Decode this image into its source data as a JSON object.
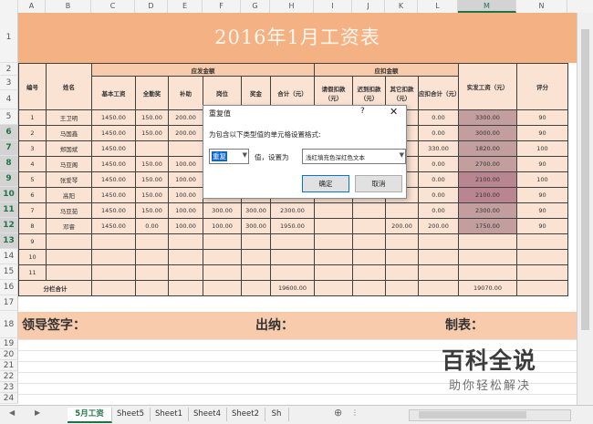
{
  "columns": [
    "A",
    "B",
    "C",
    "D",
    "E",
    "F",
    "G",
    "H",
    "I",
    "J",
    "K",
    "L",
    "M",
    "N"
  ],
  "rows": [
    "1",
    "2",
    "3",
    "4",
    "5",
    "6",
    "7",
    "8",
    "9",
    "10",
    "11",
    "12",
    "13",
    "14",
    "15",
    "16",
    "17",
    "18",
    "19",
    "20",
    "21",
    "22",
    "23",
    "24"
  ],
  "title": "2016年1月工资表",
  "headers": {
    "id": "编号",
    "name": "姓名",
    "payable_group": "应发金额",
    "deduct_group": "应扣金额",
    "net": "实发工资（元）",
    "score": "评分",
    "base": "基本工资",
    "attendance": "全勤奖",
    "subsidy": "补助",
    "post": "岗位",
    "bonus": "奖金",
    "total": "合计（元）",
    "leave": "请假扣款（元）",
    "late": "迟到扣款（元）",
    "other": "其它扣款（元）",
    "deduct_total": "应扣合计（元）"
  },
  "records": [
    {
      "no": "1",
      "name": "王卫明",
      "base": "1450.00",
      "att": "150.00",
      "sub": "200.00",
      "post": "",
      "bonus": "",
      "total": "",
      "leave": "",
      "late": "",
      "other": "",
      "dtotal": "0.00",
      "net": "3300.00",
      "score": "90"
    },
    {
      "no": "2",
      "name": "马国鑫",
      "base": "1450.00",
      "att": "150.00",
      "sub": "200.00",
      "post": "",
      "bonus": "",
      "total": "",
      "leave": "",
      "late": "",
      "other": "",
      "dtotal": "0.00",
      "net": "3000.00",
      "score": "90"
    },
    {
      "no": "3",
      "name": "郑国斌",
      "base": "1450.00",
      "att": "",
      "sub": "",
      "post": "",
      "bonus": "",
      "total": "",
      "leave": "",
      "late": "",
      "other": "",
      "dtotal": "330.00",
      "net": "1820.00",
      "score": "100"
    },
    {
      "no": "4",
      "name": "马亚阁",
      "base": "1450.00",
      "att": "150.00",
      "sub": "100.00",
      "post": "",
      "bonus": "",
      "total": "",
      "leave": "",
      "late": "",
      "other": "",
      "dtotal": "0.00",
      "net": "2700.00",
      "score": "90"
    },
    {
      "no": "5",
      "name": "张爱琴",
      "base": "1450.00",
      "att": "150.00",
      "sub": "100.00",
      "post": "",
      "bonus": "",
      "total": "",
      "leave": "",
      "late": "",
      "other": "",
      "dtotal": "0.00",
      "net": "2100.00",
      "score": "100"
    },
    {
      "no": "6",
      "name": "高阳",
      "base": "1450.00",
      "att": "150.00",
      "sub": "100.00",
      "post": "",
      "bonus": "",
      "total": "",
      "leave": "",
      "late": "",
      "other": "",
      "dtotal": "0.00",
      "net": "2100.00",
      "score": "90"
    },
    {
      "no": "7",
      "name": "马亚茹",
      "base": "1450.00",
      "att": "150.00",
      "sub": "100.00",
      "post": "300.00",
      "bonus": "300.00",
      "total": "2300.00",
      "leave": "",
      "late": "",
      "other": "",
      "dtotal": "0.00",
      "net": "2300.00",
      "score": "90"
    },
    {
      "no": "8",
      "name": "邓睿",
      "base": "1450.00",
      "att": "0.00",
      "sub": "100.00",
      "post": "100.00",
      "bonus": "300.00",
      "total": "1950.00",
      "leave": "",
      "late": "",
      "other": "200.00",
      "dtotal": "200.00",
      "net": "1750.00",
      "score": "90"
    }
  ],
  "empty_rows": [
    "9",
    "10",
    "11"
  ],
  "subtotal": {
    "label": "分栏合计",
    "total": "19600.00",
    "net": "19070.00"
  },
  "signatures": {
    "leader": "领导签字：",
    "cashier": "出纳：",
    "maker": "制表："
  },
  "dialog": {
    "title": "重复值",
    "help": "?",
    "close": "✕",
    "prompt": "为包含以下类型值的单元格设置格式:",
    "type_value": "重复",
    "mid_text": "值，设置为",
    "format_value": "浅红填充色深红色文本",
    "ok": "确定",
    "cancel": "取消"
  },
  "tabs": [
    "5月工资",
    "Sheet5",
    "Sheet1",
    "Sheet4",
    "Sheet2",
    "Sh"
  ],
  "active_tab": "5月工资",
  "watermark": {
    "big": "百科全说",
    "small": "助你轻松解决"
  }
}
